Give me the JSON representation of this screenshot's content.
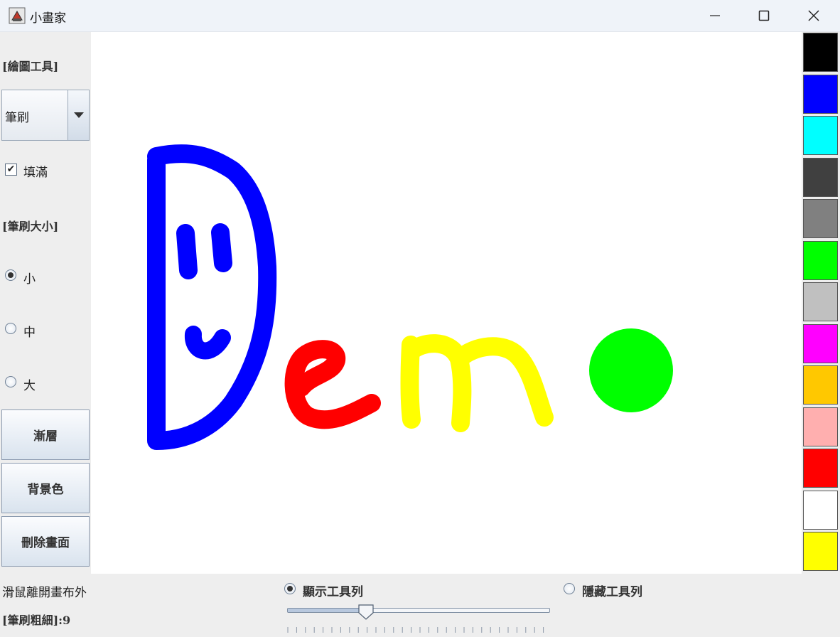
{
  "window": {
    "title": "小畫家",
    "icon": "java-cup-icon"
  },
  "toolbar": {
    "tools_label": "[繪圖工具]",
    "tool_selected": "筆刷",
    "fill_label": "填滿",
    "fill_checked": true,
    "brush_size_label": "[筆刷大小]",
    "sizes": [
      {
        "label": "小",
        "selected": true
      },
      {
        "label": "中",
        "selected": false
      },
      {
        "label": "大",
        "selected": false
      }
    ],
    "gradient_label": "漸層",
    "background_label": "背景色",
    "clear_label": "刪除畫面"
  },
  "palette": [
    "#000000",
    "#0000ff",
    "#00ffff",
    "#404040",
    "#808080",
    "#00ff00",
    "#c0c0c0",
    "#ff00ff",
    "#ffc800",
    "#ffafaf",
    "#ff0000",
    "#ffffff",
    "#ffff00"
  ],
  "drawing": {
    "colors": {
      "d": "#0000ff",
      "e": "#ff0000",
      "m": "#ffff00",
      "dot": "#00ff00"
    }
  },
  "statusbar": {
    "mouse_status": "滑鼠離開畫布外",
    "show_toolbar": "顯示工具列",
    "hide_toolbar": "隱藏工具列",
    "show_selected": true,
    "brush_width_label": "[筆刷粗細]:9",
    "brush_width_value": 9,
    "slider_fraction": 0.3
  }
}
